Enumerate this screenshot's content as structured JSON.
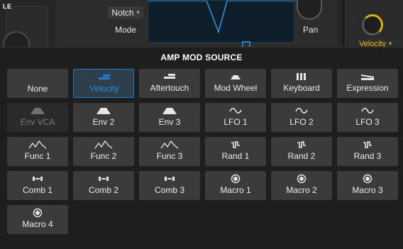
{
  "background": {
    "corner_label": "LE",
    "filter_type": "Notch",
    "mode_label": "Mode",
    "pan_label": "Pan",
    "amp_source_value": "Velocity"
  },
  "colors": {
    "accent_blue": "#1e7fd6",
    "accent_yellow": "#e9c21a",
    "tile_bg": "#3b3b3b",
    "popup_bg": "#1e1e1e"
  },
  "popup": {
    "title": "AMP MOD SOURCE",
    "tiles": [
      {
        "label": "None",
        "icon": "none",
        "state": "normal"
      },
      {
        "label": "Velocity",
        "icon": "velocity-icon",
        "state": "selected"
      },
      {
        "label": "Aftertouch",
        "icon": "aftertouch-icon",
        "state": "normal"
      },
      {
        "label": "Mod Wheel",
        "icon": "mod-wheel-icon",
        "state": "normal"
      },
      {
        "label": "Keyboard",
        "icon": "keyboard-icon",
        "state": "normal"
      },
      {
        "label": "Expression",
        "icon": "expression-pedal-icon",
        "state": "normal"
      },
      {
        "label": "Env VCA",
        "icon": "envelope-icon",
        "state": "disabled"
      },
      {
        "label": "Env 2",
        "icon": "envelope-icon",
        "state": "normal"
      },
      {
        "label": "Env 3",
        "icon": "envelope-icon",
        "state": "normal"
      },
      {
        "label": "LFO 1",
        "icon": "sine-wave-icon",
        "state": "normal"
      },
      {
        "label": "LFO 2",
        "icon": "sine-wave-icon",
        "state": "normal"
      },
      {
        "label": "LFO 3",
        "icon": "sine-wave-icon",
        "state": "normal"
      },
      {
        "label": "Func 1",
        "icon": "function-curve-icon",
        "state": "normal"
      },
      {
        "label": "Func 2",
        "icon": "function-curve-icon",
        "state": "normal"
      },
      {
        "label": "Func 3",
        "icon": "function-curve-icon",
        "state": "normal"
      },
      {
        "label": "Rand 1",
        "icon": "random-step-icon",
        "state": "normal"
      },
      {
        "label": "Rand 2",
        "icon": "random-step-icon",
        "state": "normal"
      },
      {
        "label": "Rand 3",
        "icon": "random-step-icon",
        "state": "normal"
      },
      {
        "label": "Comb 1",
        "icon": "combinator-icon",
        "state": "normal"
      },
      {
        "label": "Comb 2",
        "icon": "combinator-icon",
        "state": "normal"
      },
      {
        "label": "Comb 3",
        "icon": "combinator-icon",
        "state": "normal"
      },
      {
        "label": "Macro 1",
        "icon": "macro-knob-icon",
        "state": "normal"
      },
      {
        "label": "Macro 2",
        "icon": "macro-knob-icon",
        "state": "normal"
      },
      {
        "label": "Macro 3",
        "icon": "macro-knob-icon",
        "state": "normal"
      },
      {
        "label": "Macro 4",
        "icon": "macro-knob-icon",
        "state": "normal"
      }
    ]
  }
}
